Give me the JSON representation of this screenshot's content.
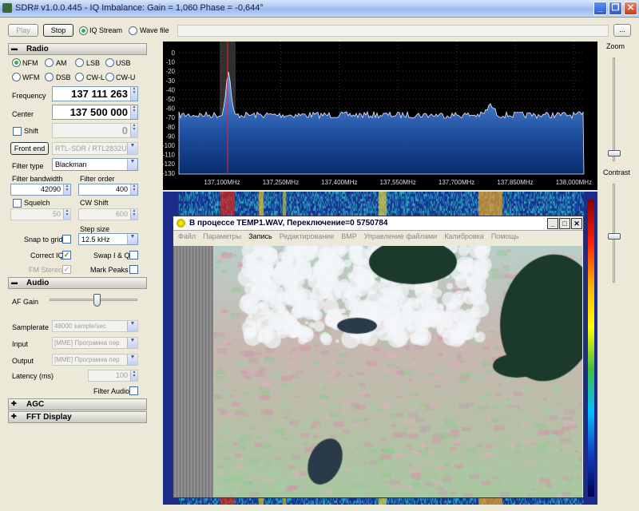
{
  "app": {
    "title": "SDR# v1.0.0.445 - IQ Imbalance: Gain = 1,060 Phase = -0,644°"
  },
  "toolbar": {
    "play_label": "Play",
    "stop_label": "Stop",
    "source_options": [
      "IQ Stream",
      "Wave file"
    ],
    "selected_source": "IQ Stream",
    "browse_label": "..."
  },
  "radio": {
    "section_title": "Radio",
    "modes_row1": [
      "NFM",
      "AM",
      "LSB",
      "USB"
    ],
    "modes_row2": [
      "WFM",
      "DSB",
      "CW-L",
      "CW-U"
    ],
    "selected_mode": "NFM",
    "frequency_label": "Frequency",
    "frequency_value": "137 111 263",
    "center_label": "Center",
    "center_value": "137 500 000",
    "shift_label": "Shift",
    "shift_value": "0",
    "front_end_label": "Front end",
    "front_end_value": "RTL-SDR / RTL2832U",
    "filter_type_label": "Filter type",
    "filter_type_value": "Blackman",
    "filter_bandwidth_label": "Filter bandwidth",
    "filter_bandwidth_value": "42090",
    "filter_order_label": "Filter order",
    "filter_order_value": "400",
    "squelch_label": "Squelch",
    "squelch_value": "50",
    "cw_shift_label": "CW Shift",
    "cw_shift_value": "600",
    "step_size_label": "Step size",
    "step_size_value": "12.5 kHz",
    "snap_label": "Snap to grid",
    "correct_iq_label": "Correct IQ",
    "swap_iq_label": "Swap I & Q",
    "fm_stereo_label": "FM Stereo",
    "mark_peaks_label": "Mark Peaks"
  },
  "audio": {
    "section_title": "Audio",
    "af_gain_label": "AF Gain",
    "af_gain_level": 0.55,
    "samplerate_label": "Samplerate",
    "samplerate_value": "48000 sample/sec",
    "input_label": "Input",
    "input_value": "[MME] Програмна пер",
    "output_label": "Output",
    "output_value": "[MME] Програмна пер",
    "latency_label": "Latency (ms)",
    "latency_value": "100",
    "filter_audio_label": "Filter Audio"
  },
  "collapsed_sections": [
    "AGC",
    "FFT Display"
  ],
  "spectrum": {
    "db_labels": [
      "0",
      "-10",
      "-20",
      "-30",
      "-40",
      "-50",
      "-60",
      "-70",
      "-80",
      "-90",
      "-100",
      "-110",
      "-120",
      "-130"
    ],
    "freq_labels": [
      "137,100MHz",
      "137,250MHz",
      "137,400MHz",
      "137,550MHz",
      "137,700MHz",
      "137,850MHz",
      "138,000MHz"
    ]
  },
  "zoom": {
    "zoom_label": "Zoom",
    "contrast_label": "Contrast",
    "zoom_level": 0.08,
    "contrast_level": 0.48
  },
  "dialog": {
    "title": "В процессе TEMP1.WAV, Переключение=0 5750784",
    "menu": [
      "Файл",
      "Параметры",
      "Запись",
      "Редактирование",
      "BMP",
      "Управление файлами",
      "Калибровка",
      "Помощь"
    ],
    "active_menu": "Запись"
  },
  "colors": {
    "title_bar": "#aac5f4",
    "spectrum_fill": "#2a5fb0",
    "marker_red": "#ff2020",
    "window_bg": "#ece9d8"
  }
}
